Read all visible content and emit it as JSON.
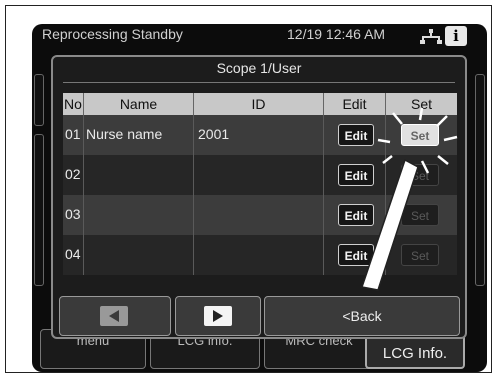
{
  "status_bar": {
    "title": "Reprocessing Standby",
    "time": "12/19 12:46 AM",
    "network_icon": "network-icon",
    "info_icon": "info-icon",
    "info_glyph": "i"
  },
  "background_buttons": {
    "menu": "menu",
    "leg_info": "LCG info.",
    "mrc_check": "MRC check",
    "lcg_info": "LCG Info."
  },
  "dialog": {
    "title": "Scope 1/User",
    "columns": [
      "No",
      "Name",
      "ID",
      "Edit",
      "Set"
    ],
    "rows": [
      {
        "no": "01",
        "name": "Nurse name",
        "id": "2001",
        "edit": "Edit",
        "set": "Set"
      },
      {
        "no": "02",
        "name": "",
        "id": "",
        "edit": "Edit",
        "set": "Set"
      },
      {
        "no": "03",
        "name": "",
        "id": "",
        "edit": "Edit",
        "set": "Set"
      },
      {
        "no": "04",
        "name": "",
        "id": "",
        "edit": "Edit",
        "set": "Set"
      }
    ],
    "nav": {
      "prev_icon": "triangle-left-icon",
      "next_icon": "triangle-right-icon",
      "back_label": "<Back"
    }
  },
  "colors": {
    "screen_bg": "#0c0c0c",
    "dialog_bg": "#1c1c1c",
    "header_bg": "#c8c8c8",
    "row_odd": "#3c3c3c",
    "row_even": "#262626"
  }
}
